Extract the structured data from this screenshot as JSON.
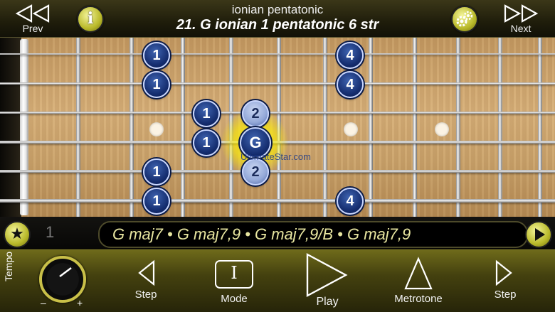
{
  "header": {
    "prev_label": "Prev",
    "next_label": "Next",
    "subtitle": "ionian pentatonic",
    "title": "21. G ionian 1 pentatonic 6 str",
    "info_icon": "info-icon",
    "settings_icon": "gear-icon"
  },
  "fretboard": {
    "watermark": "UltimateStar.com",
    "root_note": "G",
    "notes": [
      {
        "label": "1",
        "string": 1,
        "fret": 3
      },
      {
        "label": "4",
        "string": 1,
        "fret": 7
      },
      {
        "label": "1",
        "string": 2,
        "fret": 3
      },
      {
        "label": "4",
        "string": 2,
        "fret": 7
      },
      {
        "label": "1",
        "string": 3,
        "fret": 4
      },
      {
        "label": "2",
        "string": 3,
        "fret": 5
      },
      {
        "label": "1",
        "string": 4,
        "fret": 4
      },
      {
        "label": "G",
        "string": 4,
        "fret": 5
      },
      {
        "label": "1",
        "string": 5,
        "fret": 3
      },
      {
        "label": "2",
        "string": 5,
        "fret": 5
      },
      {
        "label": "1",
        "string": 6,
        "fret": 3
      },
      {
        "label": "4",
        "string": 6,
        "fret": 7
      }
    ]
  },
  "chords": {
    "count": "1",
    "text": "G maj7 • G maj7,9 • G maj7,9/B • G maj7,9"
  },
  "controls": {
    "tempo_label": "Tempo",
    "tempo_minus": "–",
    "tempo_plus": "+",
    "step_back_label": "Step",
    "mode_label": "Mode",
    "mode_glyph": "I",
    "play_label": "Play",
    "metrotone_label": "Metrotone",
    "step_forward_label": "Step"
  }
}
